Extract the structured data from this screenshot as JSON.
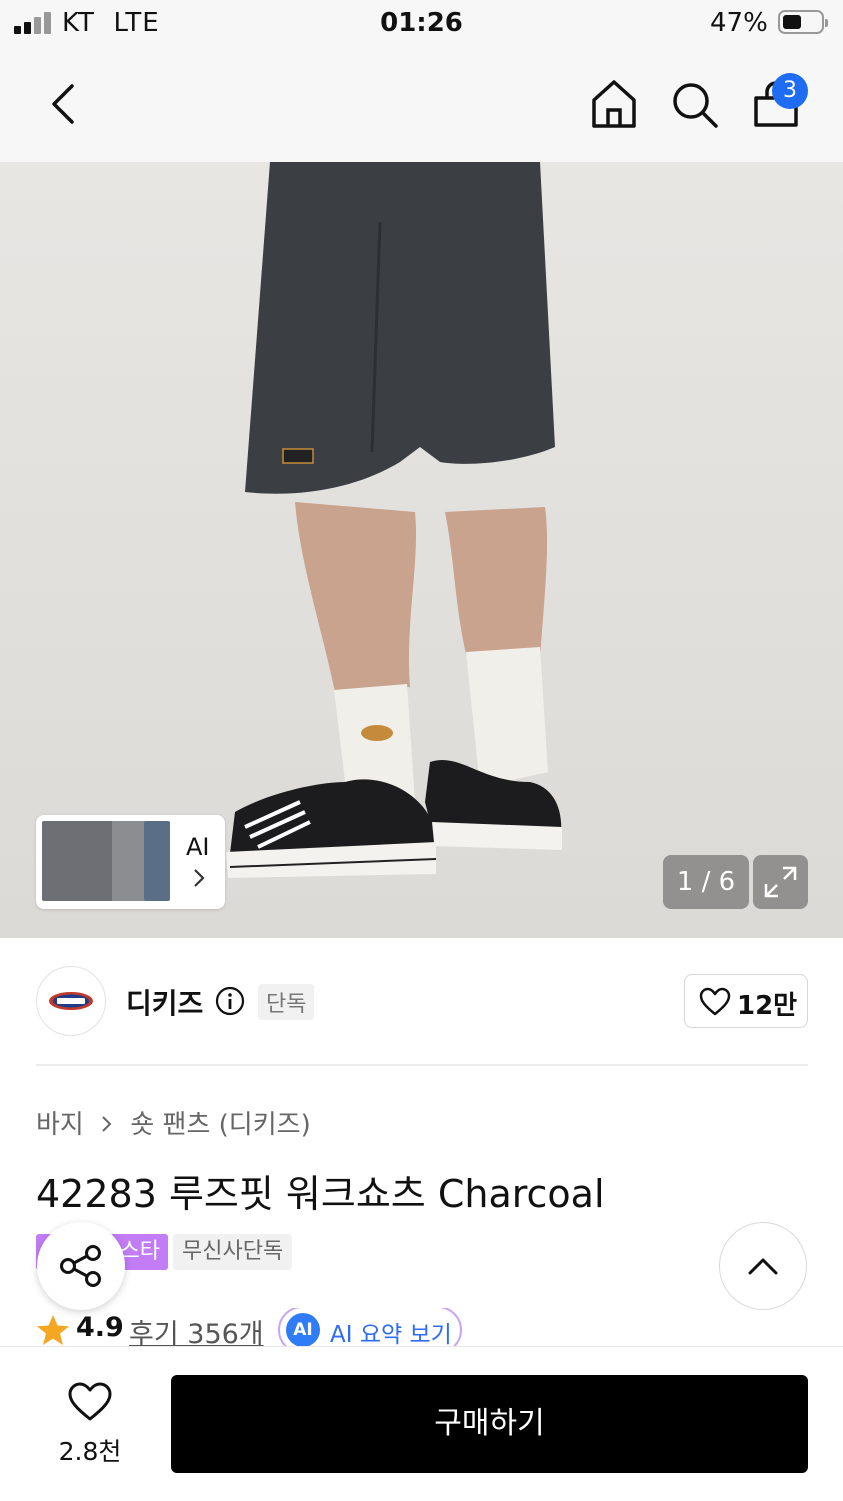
{
  "status_bar": {
    "carrier": "KT  LTE",
    "time": "01:26",
    "battery": "47%"
  },
  "nav": {
    "cart_badge": "3"
  },
  "gallery": {
    "thumb_label": "AI",
    "counter": "1 / 6"
  },
  "brand": {
    "name": "디키즈",
    "exclusive_tag": "단독",
    "like_count": "12만"
  },
  "breadcrumb": {
    "category": "바지",
    "sub_category": "숏 팬츠 (디키즈)"
  },
  "product": {
    "title": "42283 루즈핏 워크쇼츠 Charcoal",
    "tag_purple": "스타",
    "tag_gray": "무신사단독",
    "rating": "4.9",
    "reviews": "후기 356개",
    "ai_icon": "AI",
    "ai_summary": "AI 요약 보기"
  },
  "bottom": {
    "wish_count": "2.8천",
    "buy_label": "구매하기"
  },
  "colors": {
    "accent_blue": "#1d6cf2",
    "tag_purple": "#c27cf5",
    "buy_button": "#000000"
  }
}
